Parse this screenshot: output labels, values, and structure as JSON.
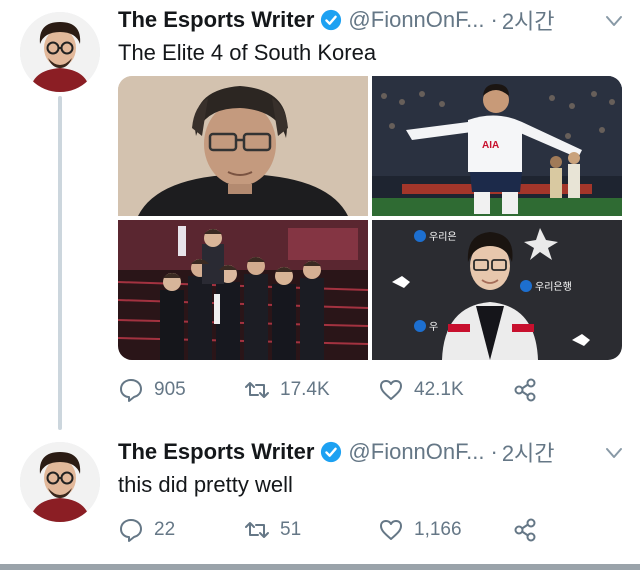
{
  "tweets": [
    {
      "author": "The Esports Writer",
      "handle": "@FionnOnF...",
      "separator": "·",
      "time": "2시간",
      "text": "The Elite 4 of South Korea",
      "replies": "905",
      "retweets": "17.4K",
      "likes": "42.1K"
    },
    {
      "author": "The Esports Writer",
      "handle": "@FionnOnF...",
      "separator": "·",
      "time": "2시간",
      "text": "this did pretty well",
      "replies": "22",
      "retweets": "51",
      "likes": "1,166"
    }
  ],
  "photo_text": {
    "jersey_sponsor": "AIA",
    "bank_sponsor_1": "우리은",
    "bank_sponsor_2": "우리은행",
    "bank_sponsor_3": "우"
  },
  "colors": {
    "verified": "#1da1f2",
    "secondary_text": "#657786",
    "thread_line": "#ccd6dd"
  },
  "icons": [
    "verified-icon",
    "chevron-down-icon",
    "reply-icon",
    "retweet-icon",
    "like-icon",
    "share-icon"
  ]
}
